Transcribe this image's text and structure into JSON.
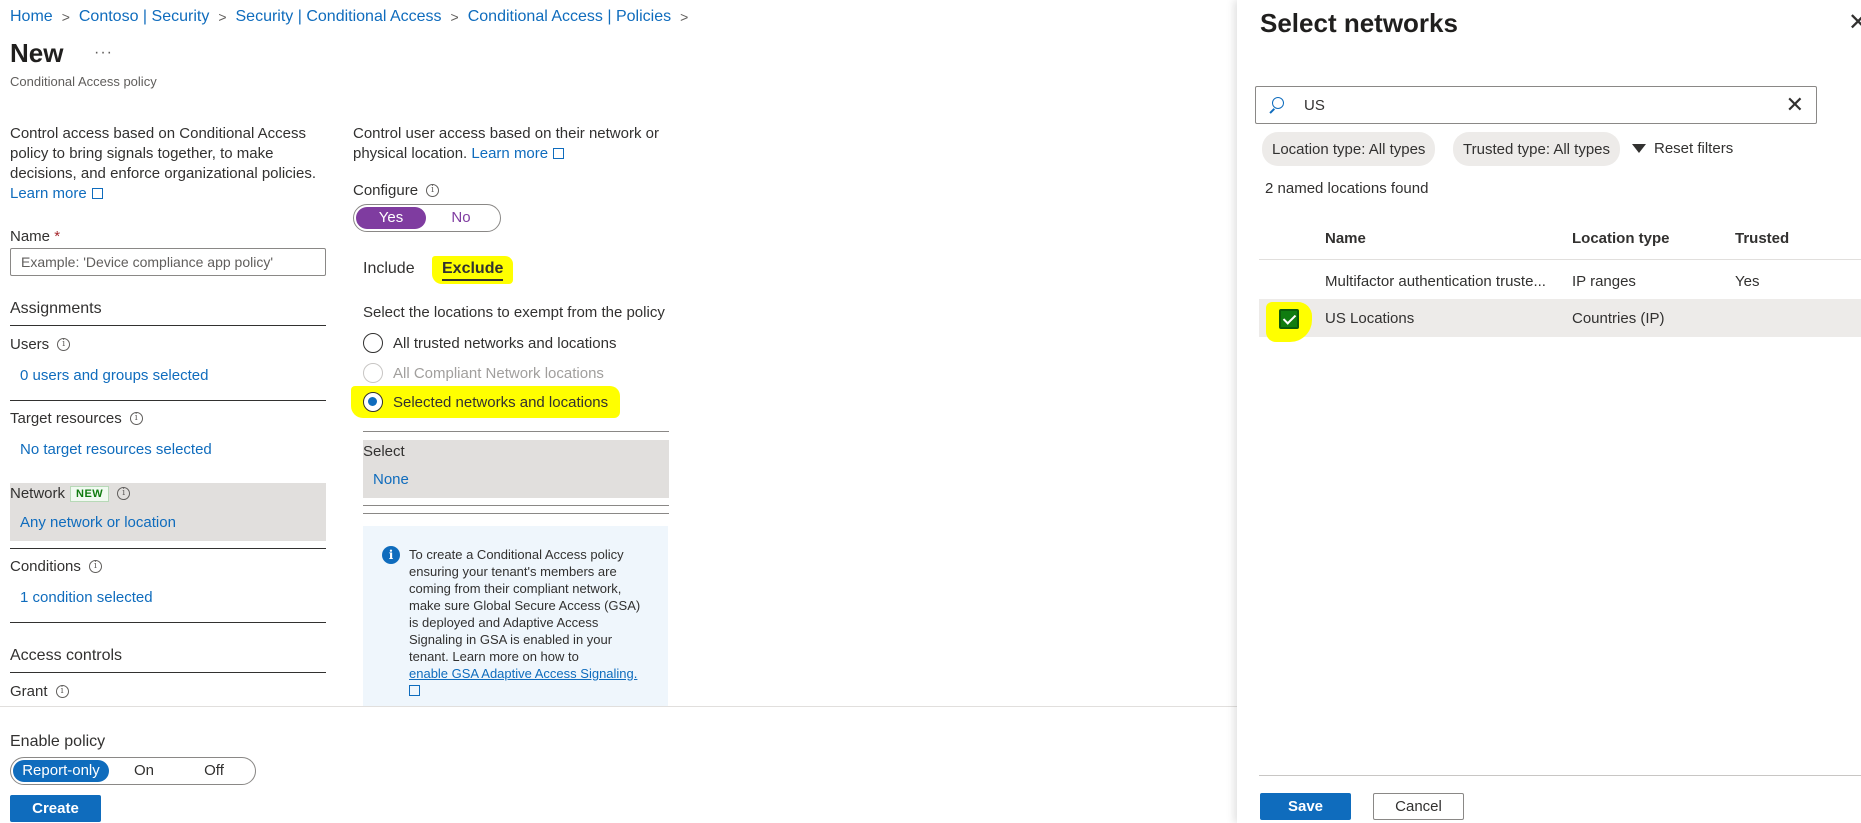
{
  "breadcrumb": [
    "Home",
    "Contoso | Security",
    "Security | Conditional Access",
    "Conditional Access | Policies"
  ],
  "page": {
    "title": "New",
    "more": "···",
    "subtitle": "Conditional Access policy"
  },
  "left": {
    "description": "Control access based on Conditional Access policy to bring signals together, to make decisions, and enforce organizational policies.",
    "learn_more": "Learn more",
    "name_label": "Name",
    "required_mark": "*",
    "name_placeholder": "Example: 'Device compliance app policy'",
    "assignments_heading": "Assignments",
    "users_label": "Users",
    "users_value": "0 users and groups selected",
    "target_label": "Target resources",
    "target_value": "No target resources selected",
    "network_label": "Network",
    "network_badge": "NEW",
    "network_value": "Any network or location",
    "conditions_label": "Conditions",
    "conditions_value": "1 condition selected",
    "access_controls_heading": "Access controls",
    "grant_label": "Grant",
    "info_glyph": "i"
  },
  "middle": {
    "description": "Control user access based on their network or physical location.",
    "learn_more": "Learn more",
    "configure_label": "Configure",
    "configure_yes": "Yes",
    "configure_no": "No",
    "tab_include": "Include",
    "tab_exclude": "Exclude",
    "exempt_label": "Select the locations to exempt from the policy",
    "radio_all_trusted": "All trusted networks and locations",
    "radio_compliant": "All Compliant Network locations",
    "radio_selected": "Selected networks and locations",
    "select_label": "Select",
    "select_value": "None",
    "info_text": "To create a Conditional Access policy ensuring your tenant's members are coming from their compliant network, make sure Global Secure Access (GSA) is deployed and Adaptive Access Signaling in GSA is enabled in your tenant. Learn more on how to",
    "info_link": "enable GSA Adaptive Access Signaling."
  },
  "bottom": {
    "enable_label": "Enable policy",
    "opt_report": "Report-only",
    "opt_on": "On",
    "opt_off": "Off",
    "create": "Create"
  },
  "panel": {
    "title": "Select networks",
    "close": "✕",
    "search_value": "US",
    "clear": "✕",
    "filter_location": "Location type: All types",
    "filter_trusted": "Trusted type: All types",
    "reset": "Reset filters",
    "found": "2 named locations found",
    "columns": {
      "name": "Name",
      "location_type": "Location type",
      "trusted": "Trusted"
    },
    "rows": [
      {
        "name": "Multifactor authentication truste...",
        "location_type": "IP ranges",
        "trusted": "Yes",
        "selected": false
      },
      {
        "name": "US Locations",
        "location_type": "Countries (IP)",
        "trusted": "",
        "selected": true
      }
    ],
    "save": "Save",
    "cancel": "Cancel"
  },
  "colors": {
    "link": "#0f6cbd",
    "toggle_purple": "#7f3ca0",
    "highlight": "#ffff00",
    "checkbox_green": "#107c10"
  },
  "icons": [
    "chevron-right-icon",
    "info-icon",
    "external-link-icon",
    "search-icon",
    "close-icon",
    "filter-icon",
    "checkmark-icon"
  ]
}
